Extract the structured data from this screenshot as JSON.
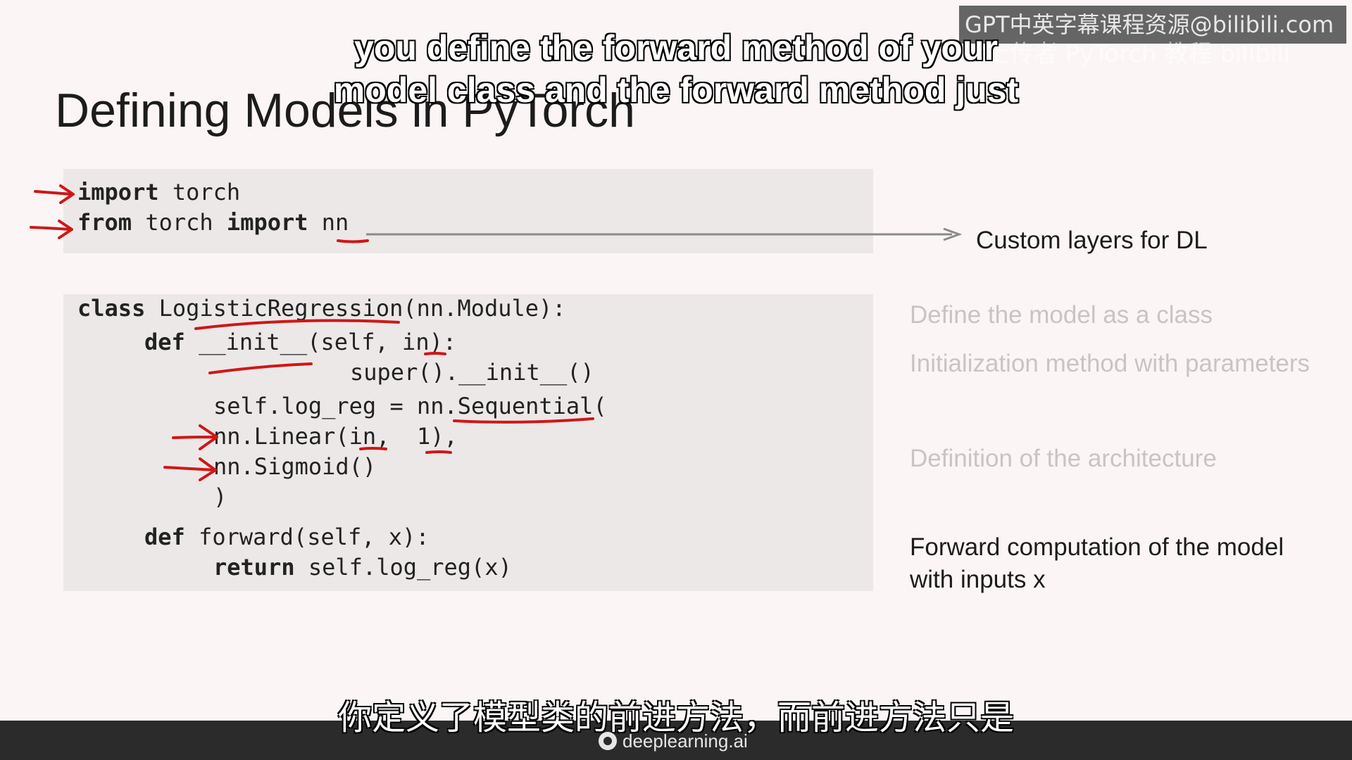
{
  "watermark": {
    "text": "GPT中英字幕课程资源@bilibili.com",
    "ghost_text": "上传者 PyTorch 教程 bilibili"
  },
  "slide": {
    "title": "Defining Models in PyTorch",
    "imports": {
      "line1": {
        "kw": "import",
        "rest": " torch"
      },
      "line2": {
        "kw1": "from",
        "mid": " torch ",
        "kw2": "import",
        "rest": " nn"
      }
    },
    "class_code": {
      "line1": {
        "kw": "class",
        "rest": " LogisticRegression(nn.Module):"
      },
      "line2": {
        "kw": "def",
        "rest": " __init__(self, in):"
      },
      "line3": "super().__init__()",
      "line4": "self.log_reg = nn.Sequential(",
      "line5": "nn.Linear(in,  1),",
      "line6": "nn.Sigmoid()",
      "line7": ")",
      "line8": {
        "kw": "def",
        "rest": " forward(self, x):"
      },
      "line9": {
        "kw": "return",
        "rest": " self.log_reg(x)"
      }
    },
    "labels": {
      "custom_layers": "Custom layers for DL",
      "define_class": "Define the model as a class",
      "init_method": "Initialization method with parameters",
      "architecture": "Definition of the architecture",
      "forward_line1": "Forward computation of the model",
      "forward_line2": "with inputs x"
    }
  },
  "captions": {
    "en_line1": "you define the forward method of your",
    "en_line2": "model class and the forward method just",
    "zh": "你定义了模型类的前进方法，而前进方法只是"
  },
  "footer": {
    "brand": "deeplearning.ai"
  },
  "colors": {
    "annotation_red": "#d01616",
    "background": "#fbf6f5",
    "code_box": "#ece8e8"
  }
}
